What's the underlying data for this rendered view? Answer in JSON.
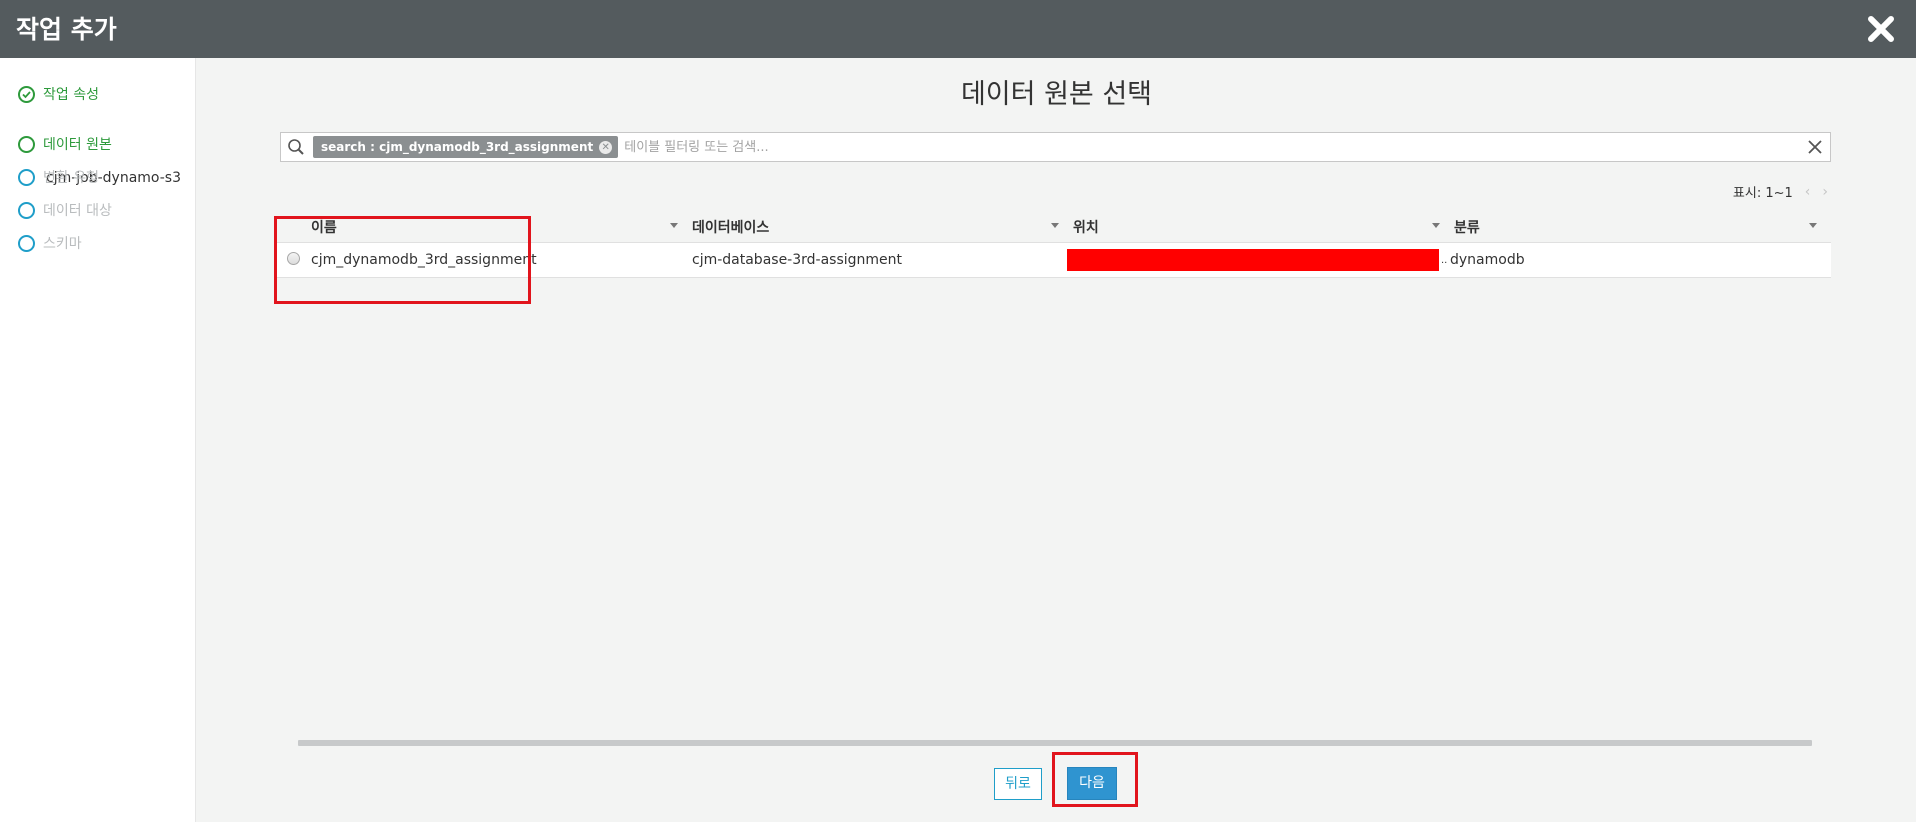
{
  "window": {
    "title": "작업 추가",
    "close_icon": "close-icon"
  },
  "sidebar": {
    "steps": [
      {
        "label": "작업 속성",
        "state": "done",
        "sub": "cjm-job-dynamo-s3"
      },
      {
        "label": "데이터 원본",
        "state": "active"
      },
      {
        "label": "변환 유형",
        "state": "pending"
      },
      {
        "label": "데이터 대상",
        "state": "pending"
      },
      {
        "label": "스키마",
        "state": "pending"
      }
    ]
  },
  "main": {
    "title": "데이터 원본 선택",
    "search": {
      "chip": "search : cjm_dynamodb_3rd_assignment",
      "placeholder": "테이블 필터링 또는 검색..."
    },
    "pagination": {
      "label": "표시: 1~1"
    },
    "table": {
      "columns": [
        "이름",
        "데이터베이스",
        "위치",
        "분류"
      ],
      "rows": [
        {
          "name": "cjm_dynamodb_3rd_assignment",
          "database": "cjm-database-3rd-assignment",
          "location_suffix": "..",
          "classification": "dynamodb"
        }
      ]
    },
    "buttons": {
      "back": "뒤로",
      "next": "다음"
    }
  },
  "colors": {
    "titlebar": "#545b5e",
    "accent": "#1f9ec9",
    "done": "#2e9a3c",
    "highlight": "#e1141c",
    "redaction": "#ff0000"
  }
}
